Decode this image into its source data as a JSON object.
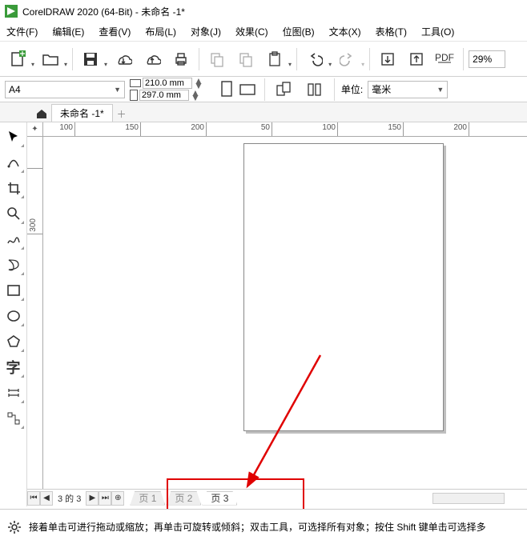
{
  "title": "CorelDRAW 2020 (64-Bit) - 未命名 -1*",
  "menu": [
    "文件(F)",
    "编辑(E)",
    "查看(V)",
    "布局(L)",
    "对象(J)",
    "效果(C)",
    "位图(B)",
    "文本(X)",
    "表格(T)",
    "工具(O)"
  ],
  "toolbar1": {
    "zoom": "29%"
  },
  "toolbar2": {
    "paper": "A4",
    "width": "210.0 mm",
    "height": "297.0 mm",
    "unit_label": "单位:",
    "unit": "毫米"
  },
  "doc_tab": "未命名 -1*",
  "ruler_h": [
    "100",
    "150",
    "200",
    "50",
    "100",
    "150",
    "200"
  ],
  "ruler_v": [
    "300"
  ],
  "page_nav": {
    "info": "3 的 3",
    "tabs": [
      "页 1",
      "页 2",
      "页 3"
    ],
    "active": 2
  },
  "status": "接着单击可进行拖动或缩放；再单击可旋转或倾斜；双击工具，可选择所有对象；按住 Shift 键单击可选择多"
}
